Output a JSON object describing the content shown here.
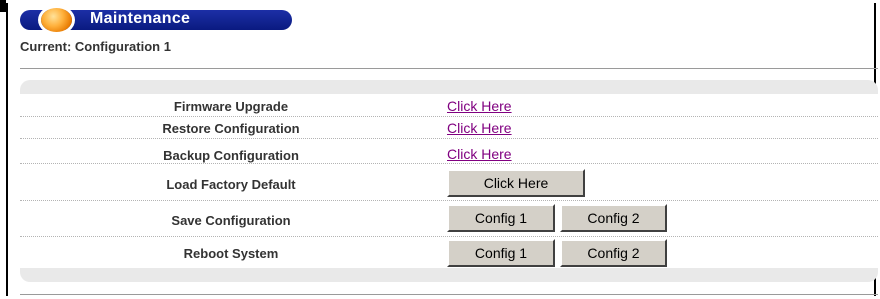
{
  "header": {
    "title": "Maintenance",
    "current": "Current: Configuration 1"
  },
  "rows": [
    {
      "label": "Firmware Upgrade",
      "action": "Click Here"
    },
    {
      "label": "Restore Configuration",
      "action": "Click Here"
    },
    {
      "label": "Backup Configuration",
      "action": "Click Here"
    },
    {
      "label": "Load Factory Default",
      "action": "Click Here"
    },
    {
      "label": "Save Configuration",
      "buttons": [
        "Config 1",
        "Config 2"
      ]
    },
    {
      "label": "Reboot System",
      "buttons": [
        "Config 1",
        "Config 2"
      ]
    }
  ],
  "colors": {
    "title_bar": "#1c2fa6",
    "orb": "#ffb13d",
    "link": "#800080",
    "panel": "#e9e9e9",
    "button_face": "#d4d0c8"
  }
}
